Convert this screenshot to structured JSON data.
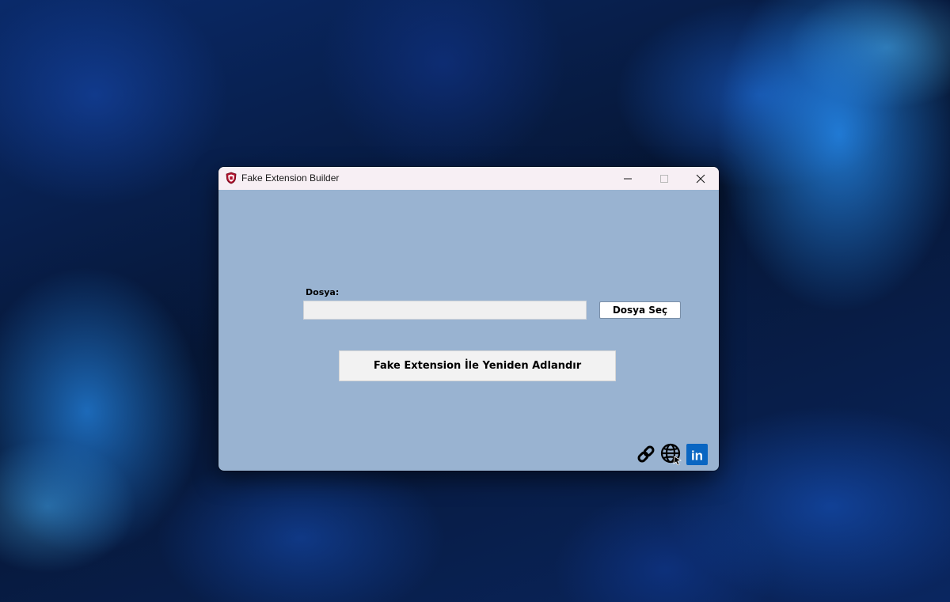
{
  "window": {
    "title": "Fake Extension Builder",
    "icon": "app-shield-icon",
    "caption_buttons": [
      "minimize-icon",
      "maximize-icon",
      "close-icon"
    ]
  },
  "form": {
    "file_label": "Dosya:",
    "file_input_value": "",
    "choose_file_label": "Dosya Seç",
    "rename_label": "Fake Extension İle Yeniden Adlandır"
  },
  "footer_icons": [
    "link-icon",
    "globe-icon",
    "linkedin-icon"
  ],
  "linkedin_text": "in",
  "colors": {
    "window_background": "#99b3d1",
    "titlebar": "#f7eff4",
    "linkedin_blue": "#0a66c2",
    "app_icon_red": "#b3122e"
  }
}
